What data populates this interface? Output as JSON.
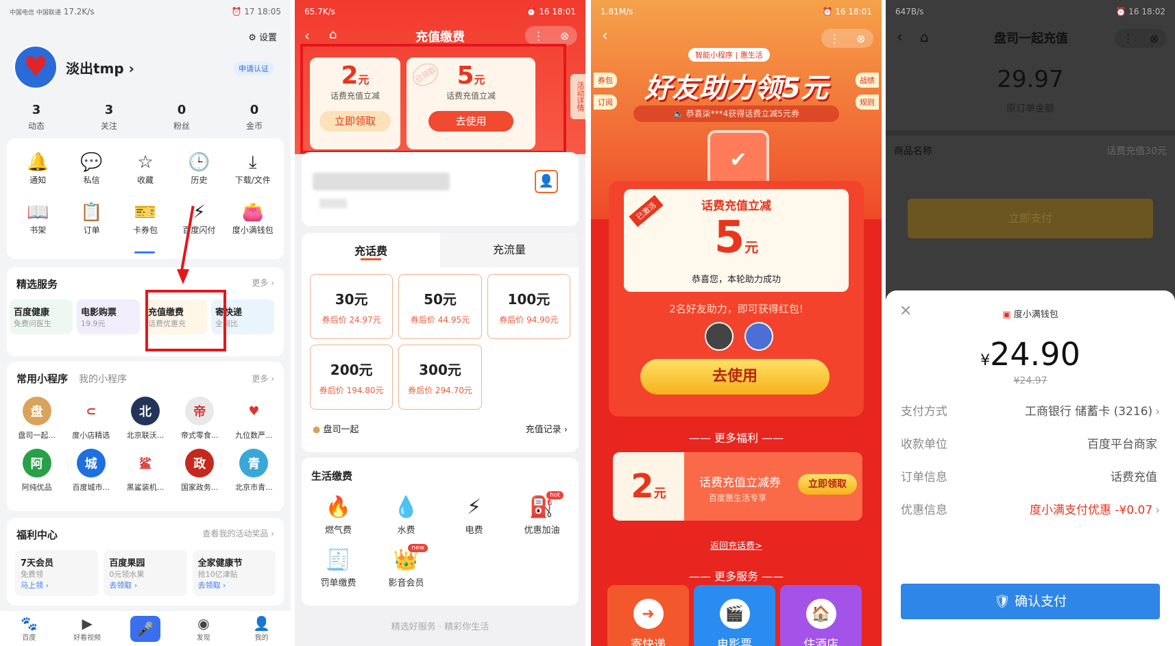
{
  "p1": {
    "status_left": "中国电信 中国联通",
    "status_speed": "17.2K/s",
    "status_battery": "17",
    "status_time": "18:05",
    "settings": "设置",
    "username": "淡出tmp",
    "verify": "申请认证",
    "stats": [
      {
        "n": "3",
        "l": "动态"
      },
      {
        "n": "3",
        "l": "关注"
      },
      {
        "n": "0",
        "l": "粉丝"
      },
      {
        "n": "0",
        "l": "金币"
      }
    ],
    "grid": [
      {
        "icon": "bell-icon",
        "g": "🔔",
        "label": "通知"
      },
      {
        "icon": "chat-icon",
        "g": "💬",
        "label": "私信"
      },
      {
        "icon": "star-icon",
        "g": "☆",
        "label": "收藏"
      },
      {
        "icon": "clock-icon",
        "g": "🕒",
        "label": "历史"
      },
      {
        "icon": "download-icon",
        "g": "⤓",
        "label": "下载/文件"
      },
      {
        "icon": "book-icon",
        "g": "📖",
        "label": "书架"
      },
      {
        "icon": "order-icon",
        "g": "📋",
        "label": "订单"
      },
      {
        "icon": "card-icon",
        "g": "🎫",
        "label": "卡券包"
      },
      {
        "icon": "flash-icon",
        "g": "⚡",
        "label": "百度闪付"
      },
      {
        "icon": "wallet-icon",
        "g": "👛",
        "label": "度小满钱包"
      }
    ],
    "featured_title": "精选服务",
    "featured_more": "更多 ›",
    "featured": [
      {
        "t": "百度健康",
        "s": "免费问医生"
      },
      {
        "t": "电影购票",
        "s": "19.9元"
      },
      {
        "t": "充值缴费",
        "s": "话费优惠充"
      },
      {
        "t": "寄快递",
        "s": "全网比"
      }
    ],
    "mini_title": "常用小程序",
    "mini_tab2": "我的小程序",
    "mini_more": "更多 ›",
    "minis": [
      {
        "l": "盘司一起...",
        "c": "#d9a35c",
        "g": "盘"
      },
      {
        "l": "度小店精选",
        "c": "#ffffff",
        "g": "⊂"
      },
      {
        "l": "北京联沃...",
        "c": "#23345a",
        "g": "北"
      },
      {
        "l": "帝式零食...",
        "c": "#e8e8e8",
        "g": "帝"
      },
      {
        "l": "九位数严...",
        "c": "#ffffff",
        "g": "♥"
      },
      {
        "l": "阿纯优品",
        "c": "#27a047",
        "g": "阿"
      },
      {
        "l": "百度城市...",
        "c": "#1e6fe0",
        "g": "城"
      },
      {
        "l": "黑鲨装机...",
        "c": "#ffffff",
        "g": "鲨"
      },
      {
        "l": "国家政务...",
        "c": "#c6281e",
        "g": "政"
      },
      {
        "l": "北京市青...",
        "c": "#3aa7d9",
        "g": "青"
      }
    ],
    "welfare_title": "福利中心",
    "welfare_more": "查看我的活动奖品 ›",
    "welfare": [
      {
        "t": "7天会员",
        "s": "免费领",
        "a": "马上领 ›"
      },
      {
        "t": "百度果园",
        "s": "0元领水果",
        "a": "去领取 ›"
      },
      {
        "t": "全家健康节",
        "s": "抢10亿津贴",
        "a": "去领取 ›"
      }
    ],
    "tabs": [
      {
        "icon": "paw-icon",
        "g": "🐾",
        "l": "百度"
      },
      {
        "icon": "video-icon",
        "g": "▶",
        "l": "好看视频"
      },
      {
        "icon": "mic-icon",
        "g": "🎤",
        "l": ""
      },
      {
        "icon": "compass-icon",
        "g": "◉",
        "l": "发现"
      },
      {
        "icon": "user-icon",
        "g": "👤",
        "l": "我的"
      }
    ]
  },
  "p2": {
    "status_speed": "65.7K/s",
    "status_battery": "16",
    "status_time": "18:01",
    "title": "充值缴费",
    "side_tab": "活动详情",
    "coupons": [
      {
        "amt": "2",
        "unit": "元",
        "desc": "话费充值立减",
        "btn": "立即领取"
      },
      {
        "amt": "5",
        "unit": "元",
        "desc": "话费充值立减",
        "btn": "去使用",
        "stamp": "已领取"
      }
    ],
    "tab_call": "充话费",
    "tab_data": "充流量",
    "chips": [
      {
        "v": "30元",
        "p": "券后价 24.97元"
      },
      {
        "v": "50元",
        "p": "券后价 44.95元"
      },
      {
        "v": "100元",
        "p": "券后价 94.90元"
      },
      {
        "v": "200元",
        "p": "券后价 194.80元"
      },
      {
        "v": "300元",
        "p": "券后价 294.70元"
      }
    ],
    "brand": "盘司一起",
    "record": "充值记录 ›",
    "life_title": "生活缴费",
    "life": [
      {
        "g": "🔥",
        "l": "燃气费",
        "icon": "gas-icon"
      },
      {
        "g": "💧",
        "l": "水费",
        "icon": "water-icon"
      },
      {
        "g": "⚡",
        "l": "电费",
        "icon": "electric-icon"
      },
      {
        "g": "⛽",
        "l": "优惠加油",
        "icon": "fuel-icon",
        "badge": "hot"
      },
      {
        "g": "🧾",
        "l": "罚单缴费",
        "icon": "ticket-icon"
      },
      {
        "g": "👑",
        "l": "影音会员",
        "icon": "crown-icon",
        "badge": "new"
      }
    ],
    "footer": "精选好服务 · 精彩你生活"
  },
  "p3": {
    "status_speed": "1.81M/s",
    "status_battery": "16",
    "status_time": "18:01",
    "pill": "智能小程序 | 惠生活",
    "headline": "好友助力领5元",
    "notice": "恭喜柒***4获得话费立减5元券",
    "left_tags": [
      "券包",
      "订阅"
    ],
    "right_tags": [
      "战绩",
      "规则"
    ],
    "card_title": "话费充值立减",
    "card_amt": "5",
    "card_unit": "元",
    "card_msg": "恭喜您，本轮助力成功",
    "stamp": "已激活",
    "helpers": "2名好友助力，即可获得红包!",
    "use_btn": "去使用",
    "more_welfare": "更多福利",
    "coupon_amt": "2",
    "coupon_unit": "元",
    "coupon_title": "话费充值立减券",
    "coupon_sub": "百度惠生活专享",
    "coupon_btn": "立即领取",
    "back": "返回充话费>",
    "more_services": "更多服务",
    "services": [
      {
        "l": "寄快递",
        "c": "#f3582d",
        "g": "➜"
      },
      {
        "l": "电影票",
        "c": "#2a8cf0",
        "g": "🎬"
      },
      {
        "l": "住酒店",
        "c": "#a453e8",
        "g": "🏠"
      }
    ]
  },
  "p4": {
    "status_speed": "647B/s",
    "status_battery": "16",
    "status_time": "18:02",
    "title": "盘司一起充值",
    "amount": "29.97",
    "amount_label": "原订单金额",
    "goods_label": "商品名称",
    "goods_value": "话费充值30元",
    "pay_now": "立即支付",
    "wallet": "度小满钱包",
    "price": "24.90",
    "currency": "¥",
    "orig_price": "¥24.97",
    "rows": [
      {
        "k": "支付方式",
        "v": "工商银行 储蓄卡 (3216)",
        "arrow": "›"
      },
      {
        "k": "收款单位",
        "v": "百度平台商家",
        "arrow": ""
      },
      {
        "k": "订单信息",
        "v": "话费充值",
        "arrow": ""
      },
      {
        "k": "优惠信息",
        "v": "度小满支付优惠 -¥0.07",
        "arrow": "›"
      }
    ],
    "confirm": "确认支付"
  }
}
